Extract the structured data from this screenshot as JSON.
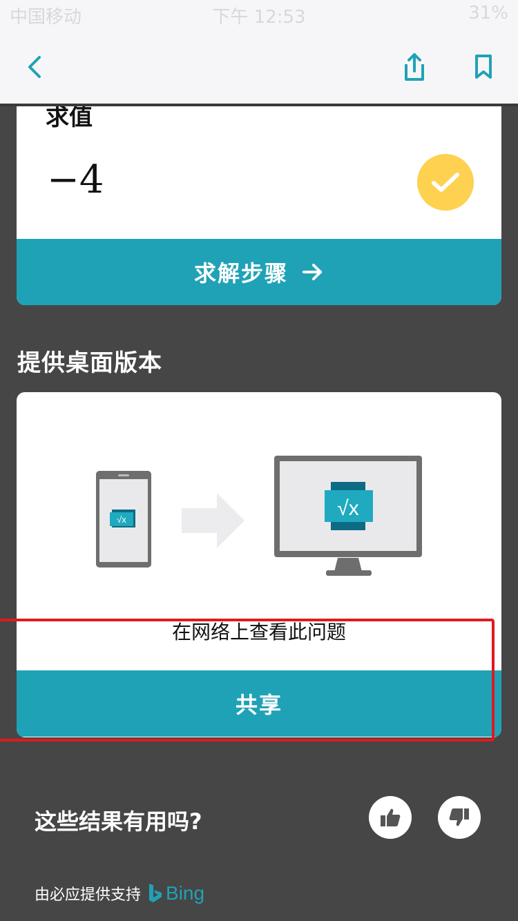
{
  "status_bar": {
    "carrier": "中国移动",
    "time": "下午 12:53",
    "battery": "31%"
  },
  "result_card": {
    "label": "求值",
    "answer": "−4",
    "steps_button": "求解步骤"
  },
  "desktop_section": {
    "title": "提供桌面版本",
    "caption": "在网络上查看此问题",
    "share_button": "共享",
    "app_icon_text": "√x"
  },
  "feedback": {
    "question": "这些结果有用吗?"
  },
  "footer": {
    "powered_by": "由必应提供支持",
    "brand": "Bing"
  },
  "colors": {
    "accent": "#20a2b6",
    "check": "#fed150",
    "background": "#464646",
    "highlight": "#e0191e"
  }
}
